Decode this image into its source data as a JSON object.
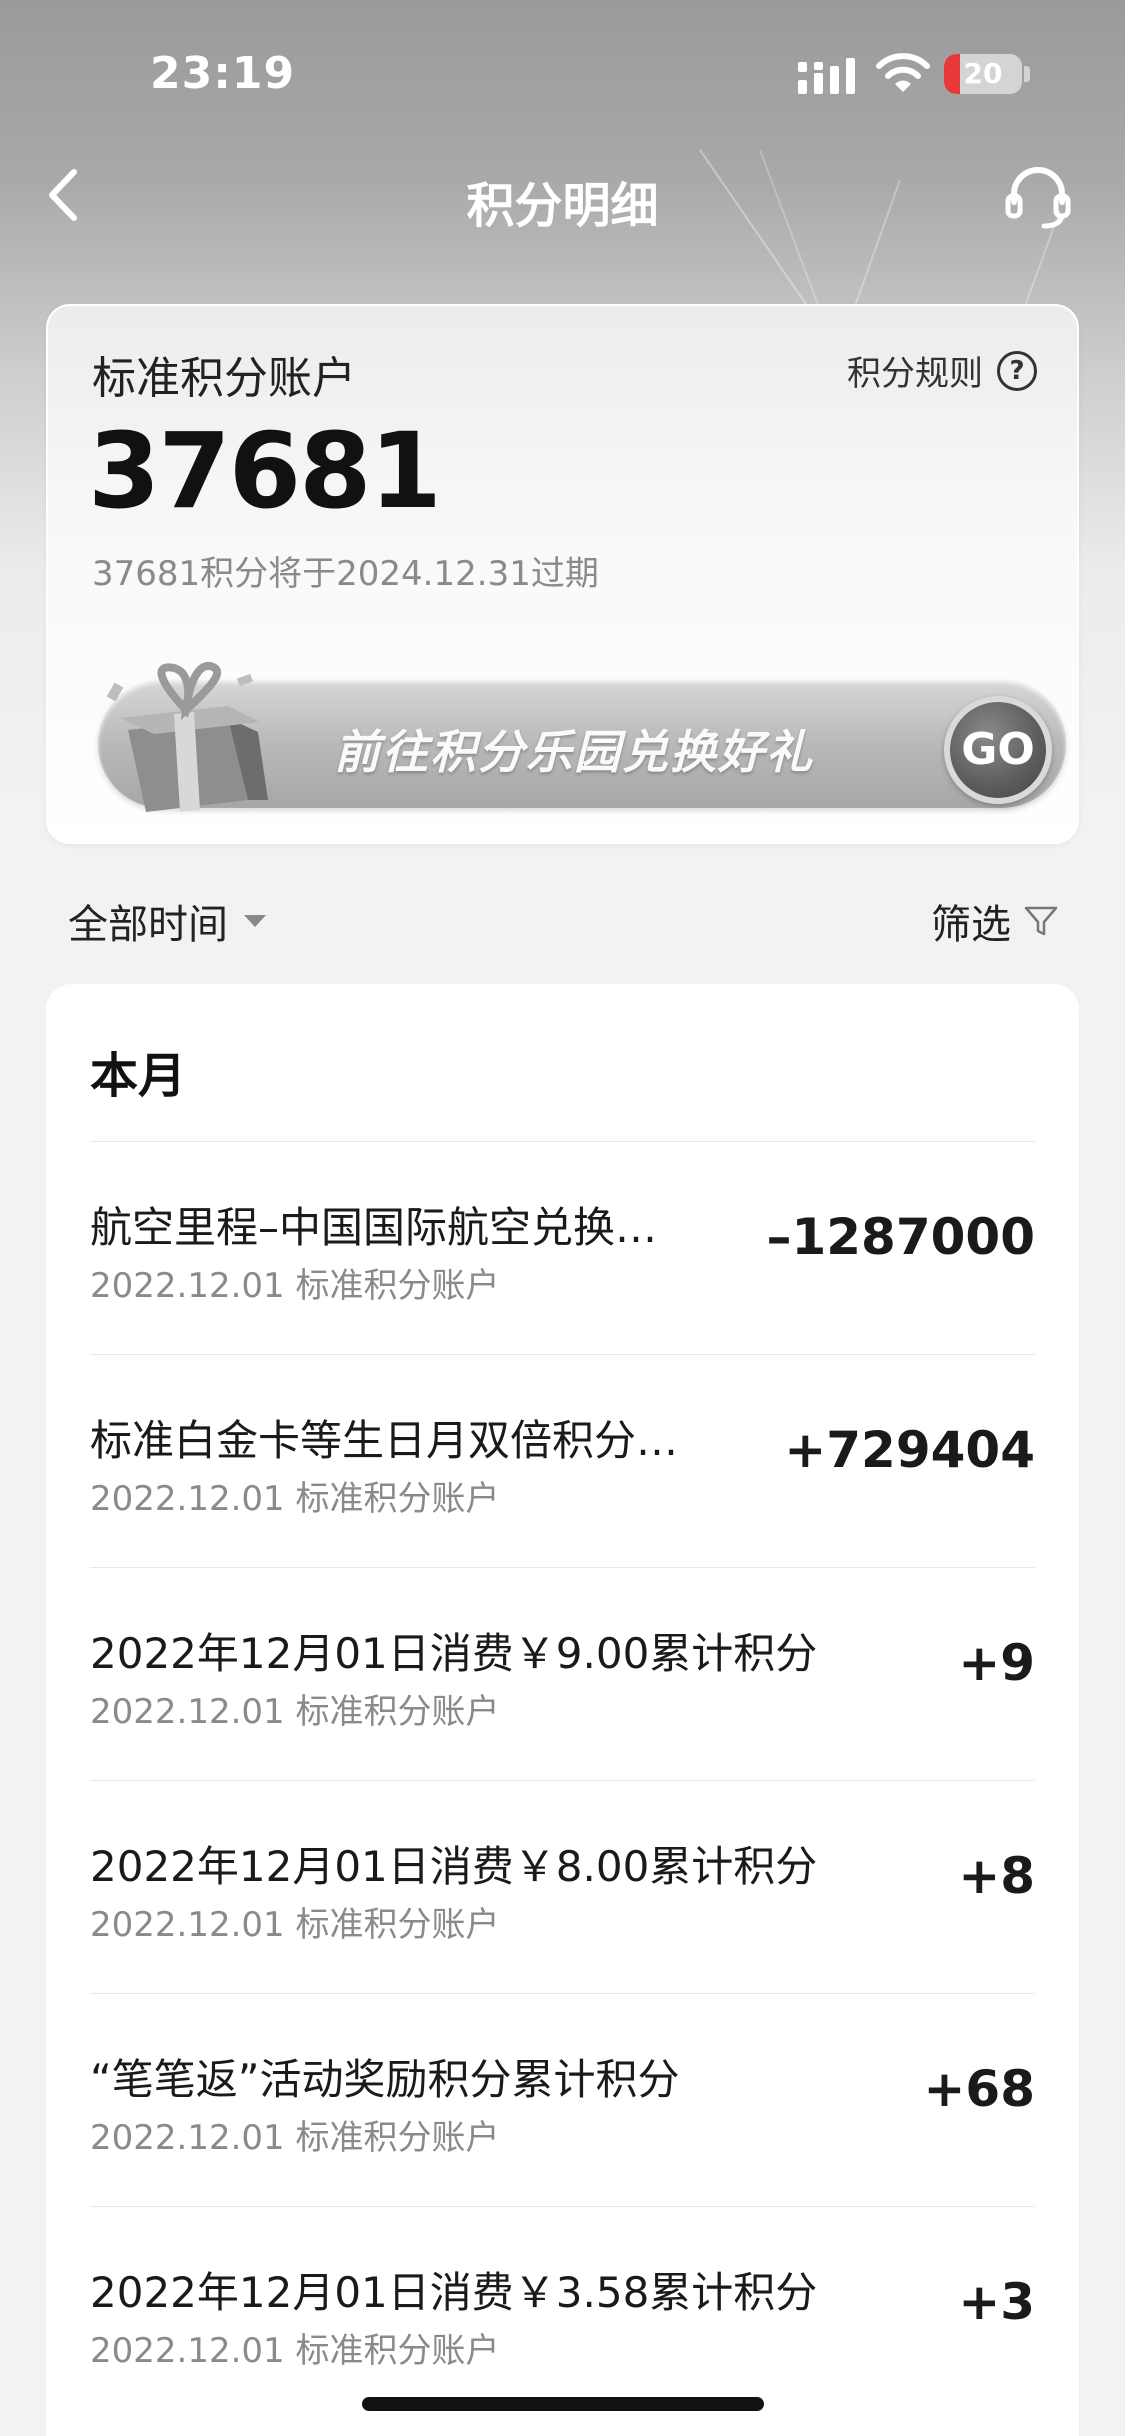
{
  "status_bar": {
    "time": "23:19",
    "battery_level": "20",
    "battery_color": "#e8393a"
  },
  "nav": {
    "title": "积分明细",
    "back_icon": "chevron-left-icon",
    "service_icon": "headset-icon"
  },
  "account": {
    "label": "标准积分账户",
    "rules_label": "积分规则",
    "rules_icon": "question-circle-icon",
    "balance": "37681",
    "expiry_text": "37681积分将于2024.12.31过期",
    "promo_text": "前往积分乐园兑换好礼",
    "promo_icon": "gift-box-icon",
    "go_label": "GO"
  },
  "filters": {
    "time_label": "全部时间",
    "filter_label": "筛选",
    "filter_icon": "funnel-icon"
  },
  "transactions": {
    "month_label": "本月",
    "items": [
      {
        "title": "航空里程–中国国际航空兑换…",
        "date": "2022.12.01",
        "account": "标准积分账户",
        "amount": "–1287000"
      },
      {
        "title": "标准白金卡等生日月双倍积分…",
        "date": "2022.12.01",
        "account": "标准积分账户",
        "amount": "+729404"
      },
      {
        "title": "2022年12月01日消费￥9.00累计积分",
        "date": "2022.12.01",
        "account": "标准积分账户",
        "amount": "+9"
      },
      {
        "title": "2022年12月01日消费￥8.00累计积分",
        "date": "2022.12.01",
        "account": "标准积分账户",
        "amount": "+8"
      },
      {
        "title": "“笔笔返”活动奖励积分累计积分",
        "date": "2022.12.01",
        "account": "标准积分账户",
        "amount": "+68"
      },
      {
        "title": "2022年12月01日消费￥3.58累计积分",
        "date": "2022.12.01",
        "account": "标准积分账户",
        "amount": "+3"
      }
    ]
  }
}
